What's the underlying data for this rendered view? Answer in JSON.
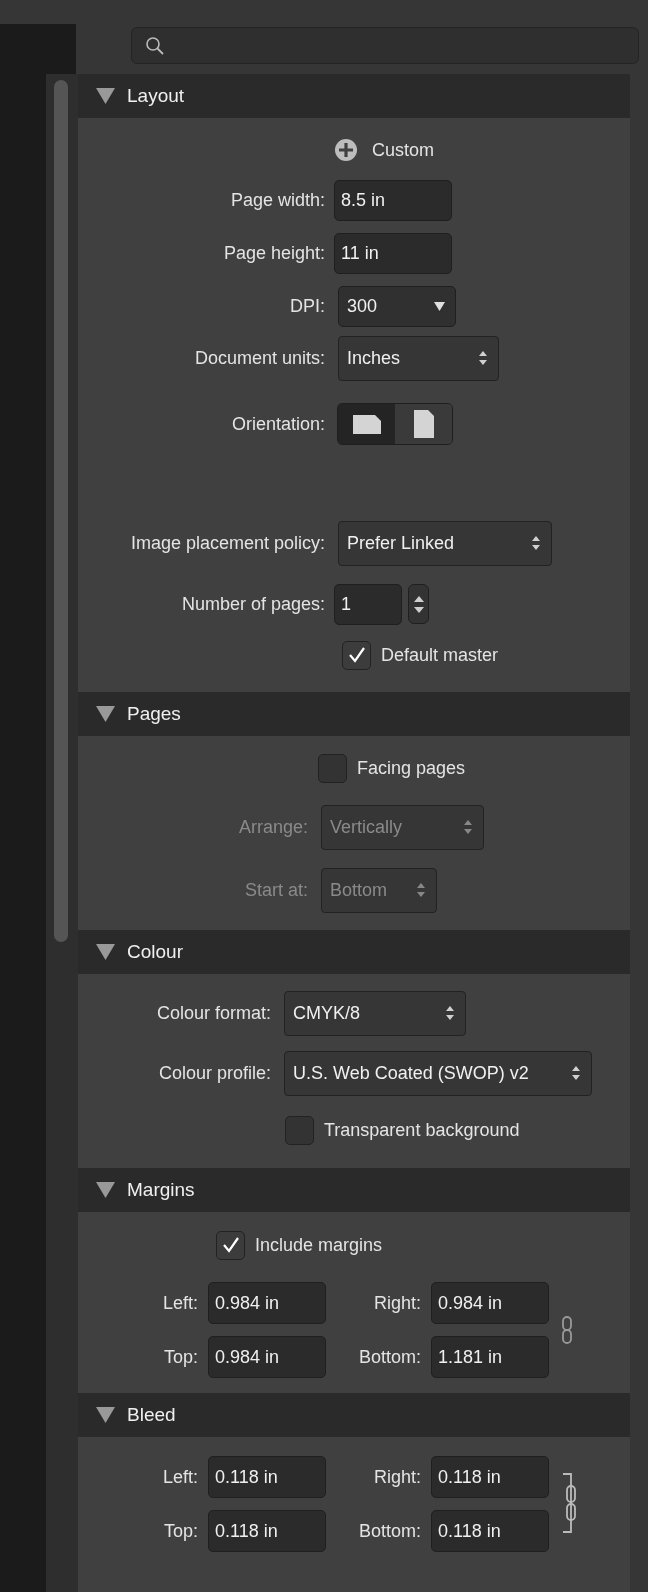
{
  "sections": [
    {
      "title": "Layout",
      "expanded": true,
      "rows": [
        {
          "kind": "button",
          "label": "Custom",
          "disabled": false
        },
        {
          "kind": "field",
          "label": "Page width:",
          "value": "8.5 in",
          "disabled": false
        },
        {
          "kind": "field",
          "label": "Page height:",
          "value": "11 in",
          "disabled": false
        },
        {
          "kind": "dropdown",
          "label": "DPI:",
          "value": "300",
          "disabled": false
        },
        {
          "kind": "select",
          "label": "Document units:",
          "value": "Inches",
          "disabled": false
        },
        {
          "kind": "segmented",
          "label": "Orientation:",
          "disabled": false,
          "options": [
            {
              "kind": "landscape",
              "selected": true
            },
            {
              "kind": "portrait",
              "selected": false
            }
          ]
        },
        {
          "kind": "select",
          "label": "Image placement policy:",
          "value": "Prefer Linked",
          "disabled": false
        },
        {
          "kind": "number",
          "label": "Number of pages:",
          "value": "1",
          "disabled": false
        },
        {
          "kind": "checkbox",
          "label": "Default master",
          "checked": true,
          "disabled": false
        }
      ]
    },
    {
      "title": "Pages",
      "expanded": true,
      "rows": [
        {
          "kind": "checkbox",
          "label": "Facing pages",
          "checked": false,
          "disabled": false
        },
        {
          "kind": "select",
          "label": "Arrange:",
          "value": "Vertically",
          "disabled": true
        },
        {
          "kind": "select",
          "label": "Start at:",
          "value": "Bottom",
          "disabled": true
        }
      ]
    },
    {
      "title": "Colour",
      "expanded": true,
      "rows": [
        {
          "kind": "select",
          "label": "Colour format:",
          "value": "CMYK/8",
          "disabled": false
        },
        {
          "kind": "select",
          "label": "Colour profile:",
          "value": "U.S. Web Coated (SWOP) v2",
          "disabled": false
        },
        {
          "kind": "checkbox",
          "label": "Transparent background",
          "checked": false,
          "disabled": false
        }
      ]
    },
    {
      "title": "Margins",
      "expanded": true,
      "rows": [
        {
          "kind": "checkbox",
          "label": "Include margins",
          "checked": true,
          "disabled": false
        },
        {
          "kind": "linked_fields",
          "linked": false,
          "disabled": false,
          "fields": [
            {
              "label": "Left:",
              "value": "0.984 in"
            },
            {
              "label": "Right:",
              "value": "0.984 in"
            },
            {
              "label": "Top:",
              "value": "0.984 in"
            },
            {
              "label": "Bottom:",
              "value": "1.181 in"
            }
          ]
        }
      ]
    },
    {
      "title": "Bleed",
      "expanded": true,
      "rows": [
        {
          "kind": "linked_fields",
          "linked": true,
          "disabled": false,
          "fields": [
            {
              "label": "Left:",
              "value": "0.118 in"
            },
            {
              "label": "Right:",
              "value": "0.118 in"
            },
            {
              "label": "Top:",
              "value": "0.118 in"
            },
            {
              "label": "Bottom:",
              "value": "0.118 in"
            }
          ]
        }
      ]
    }
  ]
}
